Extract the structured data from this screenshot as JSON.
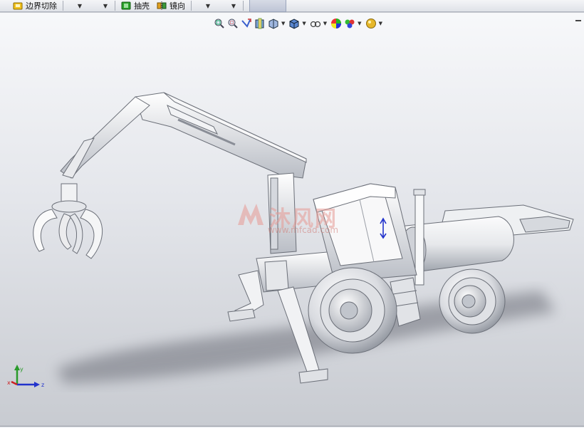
{
  "toolbar": {
    "items": [
      {
        "label": "边界切除",
        "icon": "boundary-cut-icon"
      },
      {
        "label": "抽壳",
        "icon": "shell-icon"
      },
      {
        "label": "镜向",
        "icon": "mirror-icon"
      }
    ],
    "colors": {
      "boundary_cut": "#f2c21b",
      "shell": "#2aa22a",
      "mirror": "#e0a020"
    }
  },
  "heads_up_toolbar": [
    {
      "icon": "zoom-to-fit-icon"
    },
    {
      "icon": "zoom-to-area-icon"
    },
    {
      "icon": "previous-view-icon"
    },
    {
      "icon": "section-view-icon"
    },
    {
      "icon": "view-orientation-icon",
      "dropdown": true
    },
    {
      "icon": "display-style-icon",
      "dropdown": true
    },
    {
      "icon": "hide-show-items-icon",
      "dropdown": true
    },
    {
      "icon": "edit-appearance-icon"
    },
    {
      "icon": "apply-scene-icon",
      "dropdown": true
    },
    {
      "icon": "view-settings-icon",
      "dropdown": true
    }
  ],
  "watermark": {
    "text": "沐风网",
    "sub": "www.mfcad.com"
  },
  "triad": {
    "x": "x",
    "y": "y",
    "z": "z"
  },
  "colors": {
    "accent": "#2244cc",
    "background": "#d2d5da",
    "model": "#eeeeee"
  }
}
